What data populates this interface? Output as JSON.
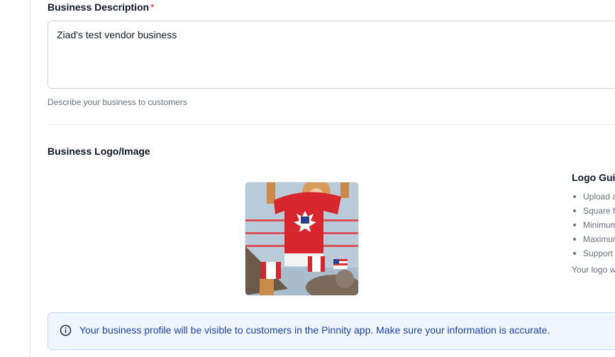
{
  "description": {
    "label": "Business Description",
    "required_marker": "*",
    "value": "Ziad's test vendor business",
    "help": "Describe your business to customers"
  },
  "logo": {
    "label": "Business Logo/Image",
    "image_alt": "cat wrestler logo image",
    "guidelines": {
      "title": "Logo Guid",
      "items": [
        "Upload a",
        "Square f",
        "Minimum",
        "Maximum",
        "Support"
      ],
      "note": "Your logo w"
    }
  },
  "alert": {
    "icon": "info-icon",
    "text": "Your business profile will be visible to customers in the Pinnity app. Make sure your information is accurate."
  },
  "colors": {
    "required": "#dc2626",
    "alert_bg": "#eff6ff",
    "alert_text": "#1e40af"
  }
}
